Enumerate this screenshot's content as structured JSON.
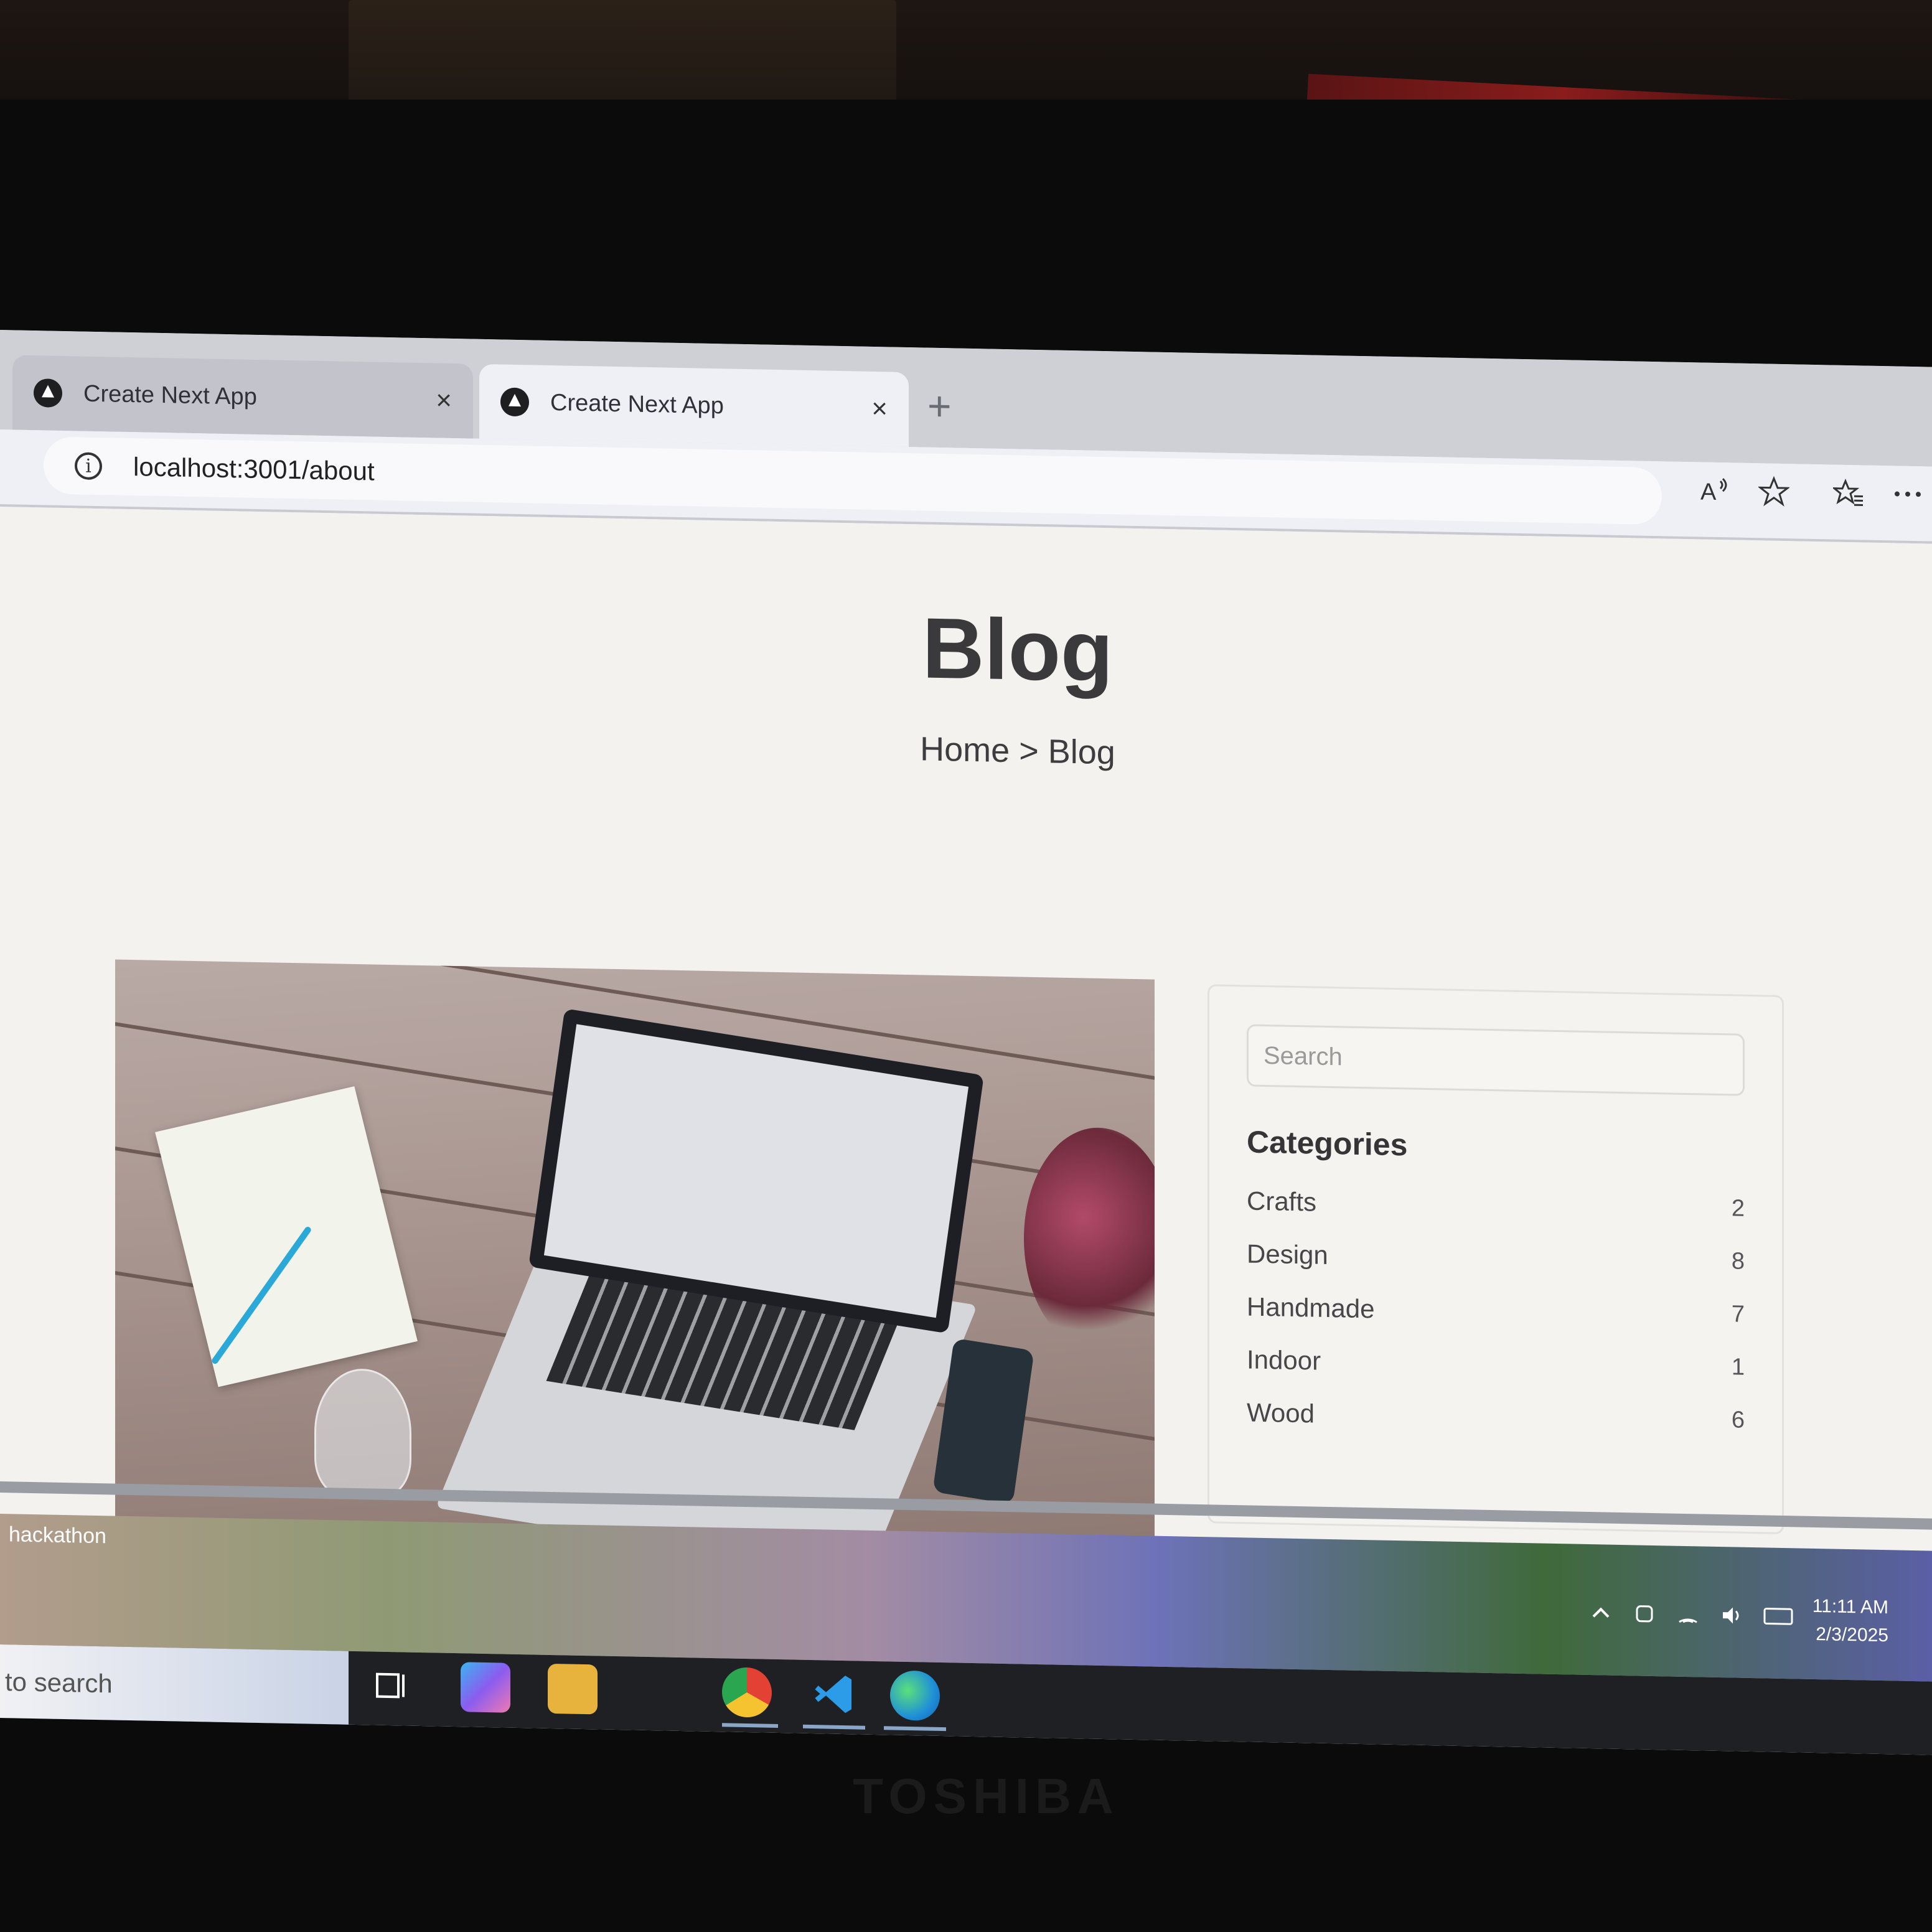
{
  "browser": {
    "tabs": [
      {
        "title": "Create Next App",
        "close": "×",
        "active": false
      },
      {
        "title": "Create Next App",
        "close": "×",
        "active": true
      }
    ],
    "new_tab": "+",
    "url": "localhost:3001/about",
    "info_glyph": "i",
    "toolbar_icons": [
      "read-aloud-icon",
      "star-icon",
      "favorites-icon",
      "more-icon"
    ]
  },
  "page": {
    "title": "Blog",
    "breadcrumb": "Home > Blog",
    "search_placeholder": "Search",
    "categories_title": "Categories",
    "categories": [
      {
        "name": "Crafts",
        "count": "2"
      },
      {
        "name": "Design",
        "count": "8"
      },
      {
        "name": "Handmade",
        "count": "7"
      },
      {
        "name": "Indoor",
        "count": "1"
      },
      {
        "name": "Wood",
        "count": "6"
      }
    ]
  },
  "desktop": {
    "folder_label": "hackathon"
  },
  "taskbar": {
    "search_text": "to search",
    "time": "11:11 AM",
    "date": "2/3/2025",
    "apps": [
      "task-view-icon",
      "copilot-icon",
      "file-explorer-icon",
      "chrome-icon",
      "vscode-icon",
      "edge-icon"
    ]
  },
  "hardware": {
    "brand": "TOSHIBA"
  }
}
